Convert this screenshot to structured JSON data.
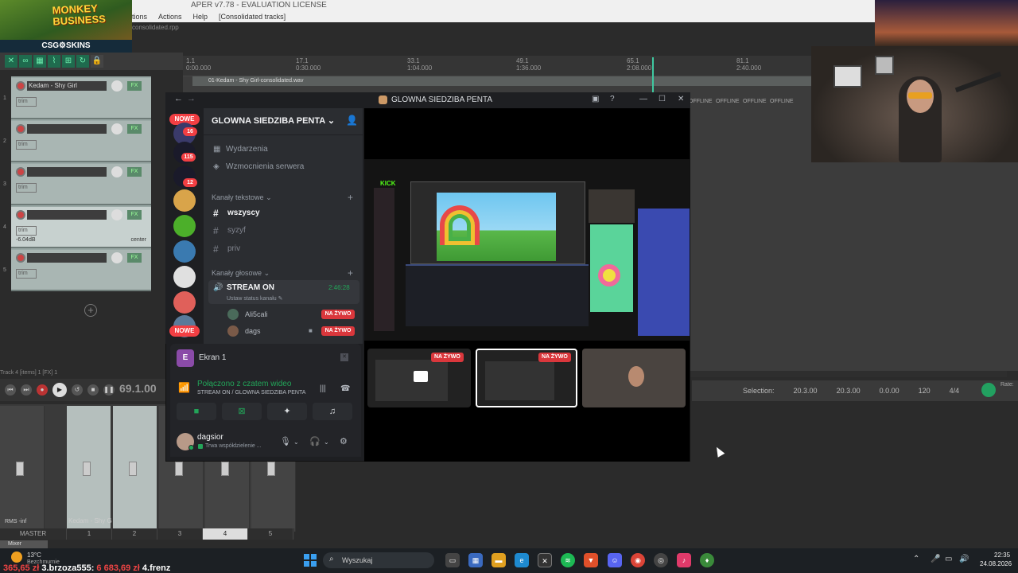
{
  "reaper": {
    "title": "APER v7.78 - EVALUATION LICENSE",
    "menu": [
      "tions",
      "Actions",
      "Help",
      "[Consolidated tracks]"
    ],
    "file": "consolidated.rpp",
    "ruler": [
      {
        "bar": "1.1",
        "time": "0:00.000"
      },
      {
        "bar": "17.1",
        "time": "0:30.000"
      },
      {
        "bar": "33.1",
        "time": "1:04.000"
      },
      {
        "bar": "49.1",
        "time": "1:36.000"
      },
      {
        "bar": "65.1",
        "time": "2:08.000"
      },
      {
        "bar": "81.1",
        "time": "2:40.000"
      }
    ],
    "clip_name": "01-Kedam - Shy Girl-consolidated.wav",
    "offline_labels": [
      "OFFLINE",
      "OFFLINE",
      "OFFLINE",
      "OFFLINE"
    ],
    "tracks": [
      {
        "num": "1",
        "name": "Kedam - Shy Girl",
        "trim": "trim",
        "db": "",
        "center": ""
      },
      {
        "num": "2",
        "name": "",
        "trim": "trim",
        "db": "",
        "center": ""
      },
      {
        "num": "3",
        "name": "",
        "trim": "trim",
        "db": "",
        "center": ""
      },
      {
        "num": "4",
        "name": "",
        "trim": "trim",
        "db": "-6.04dB",
        "center": "center"
      },
      {
        "num": "5",
        "name": "",
        "trim": "trim",
        "db": "",
        "center": ""
      }
    ],
    "track_info": "Track 4 [items] 1 [FX] 1",
    "time_display": "69.1.00",
    "selection": {
      "label": "Selection:",
      "start": "20.3.00",
      "end": "20.3.00",
      "length": "0.0.00"
    },
    "bpm": "120",
    "sig": "4/4",
    "rate": "Rate:",
    "mixer": {
      "master": "MASTER",
      "strips": [
        "1",
        "2",
        "3",
        "4",
        "5"
      ],
      "kedam": "Kedam - Shy G",
      "rms": "RMS",
      "inf": "-inf",
      "tab": "Mixer"
    }
  },
  "overlay": {
    "monkey_logo": "MONKEY BUSINESS",
    "csg_logo": "CSG⚙SKINS"
  },
  "discord": {
    "window_title": "GLOWNA SIEDZIBA PENTA",
    "server_badges": [
      "NOWE",
      "16",
      "115",
      "12",
      "NOWE"
    ],
    "guild_name": "GLOWNA SIEDZIBA PENTA",
    "nav": [
      {
        "icon": "calendar-icon",
        "label": "Wydarzenia"
      },
      {
        "icon": "boost-icon",
        "label": "Wzmocnienia serwera"
      }
    ],
    "text_category": "Kanały tekstowe",
    "text_channels": [
      {
        "name": "wszyscy",
        "active": true
      },
      {
        "name": "syzyf",
        "active": false
      },
      {
        "name": "priv",
        "active": false
      }
    ],
    "voice_category": "Kanały głosowe",
    "voice_channel": {
      "name": "STREAM ON",
      "timer": "2:46:28",
      "status": "Ustaw status kanału"
    },
    "voice_users": [
      {
        "name": "Ali5cali",
        "badge": "NA ŻYWO"
      },
      {
        "name": "dags",
        "badge": "NA ŻYWO"
      }
    ],
    "screen": {
      "app_letter": "E",
      "title": "Ekran 1",
      "connected": "Połączono z czatem wideo",
      "connected_sub": "STREAM ON / GLOWNA SIEDZIBA PENTA"
    },
    "user": {
      "name": "dagsior",
      "status": "Trwa współdzielenie ..."
    },
    "stream": {
      "kick_label": "KICK",
      "thumb_badges": [
        "NA ŻYWO",
        "NA ŻYWO"
      ]
    }
  },
  "taskbar": {
    "weather_temp": "13°C",
    "weather_desc": "Bezchmurnie",
    "ticker": {
      "first": "365,65 zł",
      "second_label": "3.brzoza555:",
      "second_value": "6 683,69 zł",
      "third": "4.frenz"
    },
    "search_placeholder": "Wyszukaj",
    "time": "22:35",
    "date": "24.08.2026"
  },
  "colors": {
    "discord_bg": "#1e1f22",
    "discord_panel": "#2b2d31",
    "live_red": "#da373c",
    "online_green": "#23a559",
    "reaper_track": "#a9b6b3"
  }
}
